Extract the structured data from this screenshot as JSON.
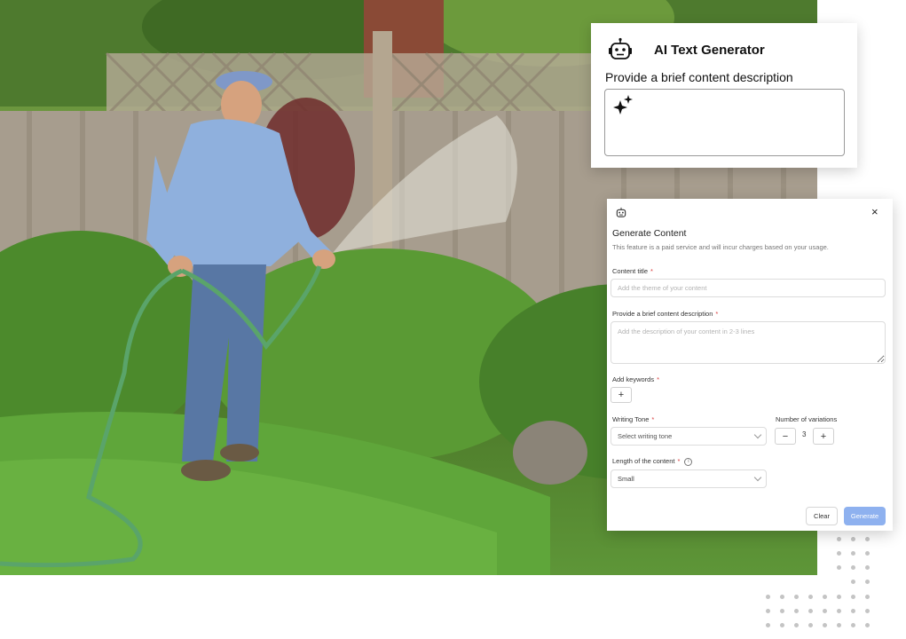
{
  "text_generator": {
    "title": "AI Text Generator",
    "description_label": "Provide a brief content description",
    "icon": "robot-icon",
    "input_icon": "sparkle-icon"
  },
  "modal": {
    "icon": "robot-icon",
    "close_label": "×",
    "title": "Generate Content",
    "subtitle": "This feature is a paid service and will incur charges based on your usage.",
    "required_marker": "*",
    "content_title": {
      "label": "Content title",
      "placeholder": "Add the theme of your content"
    },
    "description": {
      "label": "Provide a brief content description",
      "placeholder": "Add the description of your content in 2-3 lines"
    },
    "keywords": {
      "label": "Add keywords",
      "add_label": "+"
    },
    "writing_tone": {
      "label": "Writing Tone",
      "placeholder": "Select writing tone"
    },
    "variations": {
      "label": "Number of variations",
      "value": "3",
      "decrement_label": "−",
      "increment_label": "+"
    },
    "length": {
      "label": "Length of the content",
      "value": "Small",
      "info_icon": "i"
    },
    "clear_label": "Clear",
    "generate_label": "Generate"
  },
  "colors": {
    "accent": "#8eb1ef",
    "required": "#d83b3b"
  }
}
